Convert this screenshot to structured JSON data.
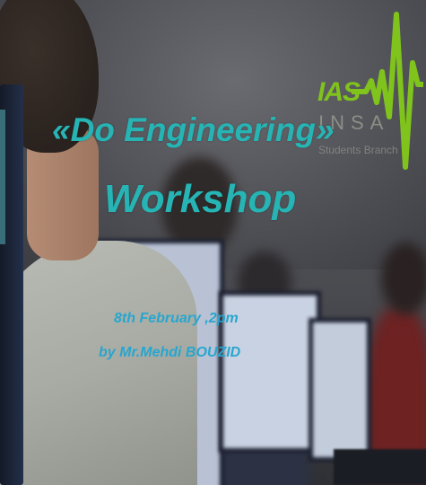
{
  "poster": {
    "title_line1": "«Do Engineering»",
    "title_line2": "Workshop",
    "date_time": "8th February ,2pm",
    "speaker": "by Mr.Mehdi BOUZID"
  },
  "logo": {
    "acronym": "IAS",
    "org": "INSA",
    "subtitle": "Students Branch",
    "icon": "waveform-logo-icon"
  },
  "colors": {
    "title": "#26b4b4",
    "info": "#27a6cf",
    "logo_green": "#7fc31c",
    "logo_gray": "#8a8f86"
  }
}
